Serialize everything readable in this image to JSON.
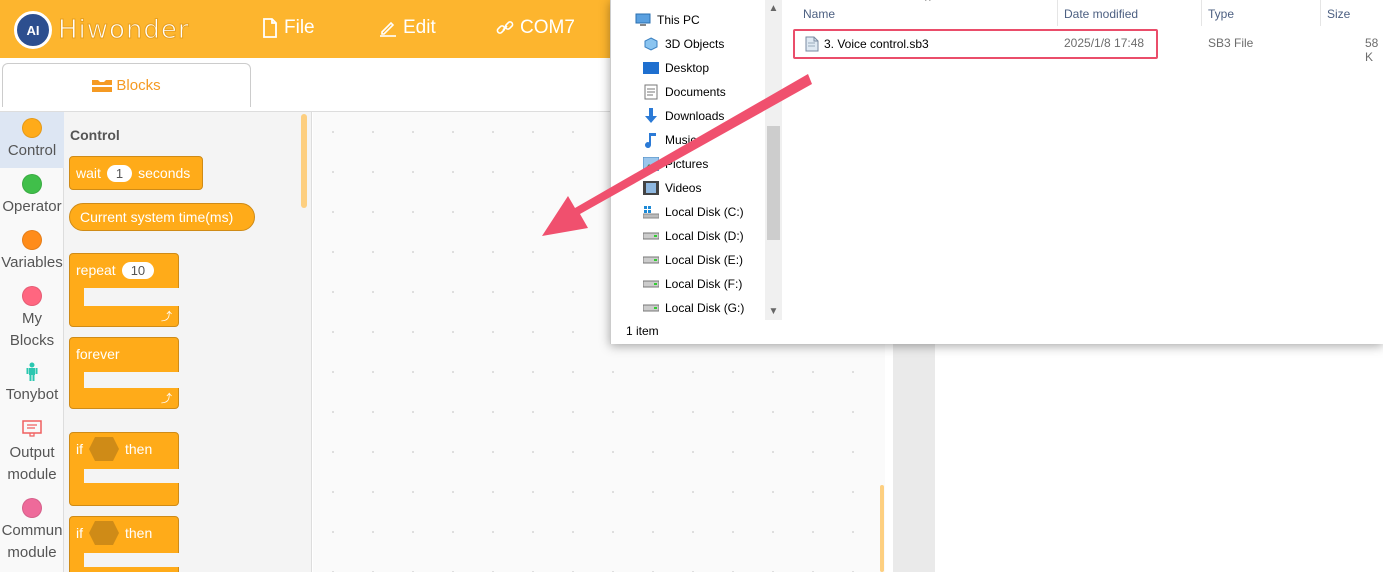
{
  "header": {
    "brand": "Hiwonder",
    "logo_badge": "AI",
    "menu": {
      "file": "File",
      "edit": "Edit",
      "port": "COM7"
    },
    "color": "#fdb52e"
  },
  "tabs": {
    "blocks": "Blocks"
  },
  "categories": [
    {
      "label": "Control",
      "color": "#ffab19",
      "icon": "dot"
    },
    {
      "label": "Operator",
      "color": "#40bf4a",
      "icon": "dot"
    },
    {
      "label": "Variables",
      "color": "#ff8c1a",
      "icon": "dot"
    },
    {
      "label": "My\nBlocks",
      "color": "#ff6680",
      "icon": "dot"
    },
    {
      "label": "Tonybot",
      "color": "#2bc7b0",
      "icon": "robot-icon"
    },
    {
      "label": "Output\nmodule",
      "color": "#f06060",
      "icon": "monitor-icon"
    },
    {
      "label": "Commun\nmodule",
      "color": "#ee6a9a",
      "icon": "dot"
    }
  ],
  "flyout": {
    "title": "Control",
    "wait": {
      "pre": "wait",
      "value": "1",
      "post": "seconds"
    },
    "current_time": "Current system time(ms)",
    "repeat": {
      "label": "repeat",
      "value": "10"
    },
    "forever": "forever",
    "if1": {
      "pre": "if",
      "post": "then"
    },
    "if2": {
      "pre": "if",
      "post": "then"
    }
  },
  "explorer": {
    "nav": [
      {
        "label": "This PC",
        "icon": "pc-icon"
      },
      {
        "label": "3D Objects",
        "icon": "cube-icon"
      },
      {
        "label": "Desktop",
        "icon": "desktop-icon"
      },
      {
        "label": "Documents",
        "icon": "documents-icon"
      },
      {
        "label": "Downloads",
        "icon": "download-icon"
      },
      {
        "label": "Music",
        "icon": "music-icon"
      },
      {
        "label": "Pictures",
        "icon": "pictures-icon"
      },
      {
        "label": "Videos",
        "icon": "videos-icon"
      },
      {
        "label": "Local Disk (C:)",
        "icon": "windows-drive-icon"
      },
      {
        "label": "Local Disk (D:)",
        "icon": "drive-icon"
      },
      {
        "label": "Local Disk (E:)",
        "icon": "drive-icon"
      },
      {
        "label": "Local Disk (F:)",
        "icon": "drive-icon"
      },
      {
        "label": "Local Disk (G:)",
        "icon": "drive-icon"
      }
    ],
    "columns": {
      "name": "Name",
      "date": "Date modified",
      "type": "Type",
      "size": "Size"
    },
    "file": {
      "name": "3. Voice control.sb3",
      "date": "2025/1/8 17:48",
      "type": "SB3 File",
      "size": "58 K"
    },
    "status": "1 item"
  }
}
